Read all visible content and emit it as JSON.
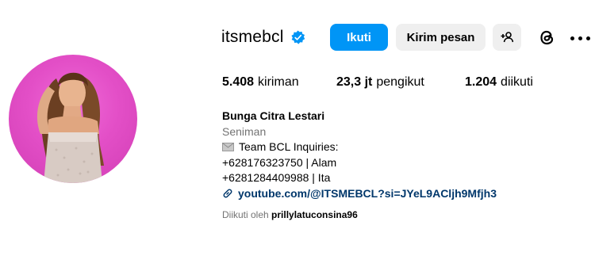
{
  "profile": {
    "username": "itsmebcl",
    "verified": true,
    "display_name": "Bunga Citra Lestari",
    "category": "Seniman",
    "bio_lines": [
      "Team BCL Inquiries:",
      "+628176323750 | Alam",
      "+6281284409988 | Ita"
    ],
    "link": "youtube.com/@ITSMEBCL?si=JYeL9ACljh9Mfjh3"
  },
  "actions": {
    "follow_label": "Ikuti",
    "message_label": "Kirim pesan"
  },
  "stats": [
    {
      "value": "5.408",
      "label": "kiriman"
    },
    {
      "value": "23,3 jt",
      "label": "pengikut"
    },
    {
      "value": "1.204",
      "label": "diikuti"
    }
  ],
  "followed_by": {
    "prefix": "Diikuti oleh",
    "user": "prillylatuconsina96"
  },
  "colors": {
    "accent": "#0095f6",
    "button_bg": "#efefef",
    "link": "#00376b",
    "muted": "#737373",
    "avatar_bg": "#e34fc7"
  },
  "icons": [
    "verified-badge-icon",
    "add-user-icon",
    "threads-icon",
    "more-options-icon",
    "mail-icon",
    "link-icon"
  ]
}
